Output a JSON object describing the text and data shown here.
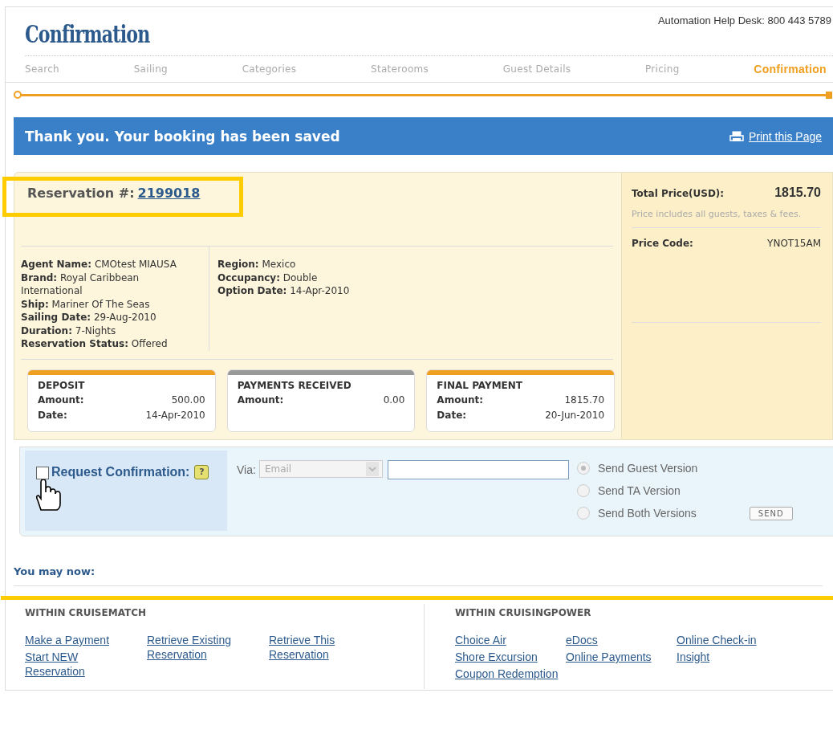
{
  "header": {
    "title": "Confirmation",
    "help_desk": "Automation Help Desk: 800 443 5789"
  },
  "steps": [
    {
      "label": "Search",
      "selected": false
    },
    {
      "label": "Sailing",
      "selected": false
    },
    {
      "label": "Categories",
      "selected": false
    },
    {
      "label": "Staterooms",
      "selected": false
    },
    {
      "label": "Guest Details",
      "selected": false
    },
    {
      "label": "Pricing",
      "selected": false
    },
    {
      "label": "Confirmation",
      "selected": true
    }
  ],
  "banner": {
    "title": "Thank you. Your booking has been saved",
    "print_link": "Print this Page"
  },
  "reservation": {
    "label": "Reservation #:",
    "number": "2199018"
  },
  "details_left": [
    {
      "label": "Agent Name:",
      "value": "CMOtest MIAUSA"
    },
    {
      "label": "Brand:",
      "value": "Royal Caribbean International"
    },
    {
      "label": "Ship:",
      "value": "Mariner Of The Seas"
    },
    {
      "label": "Sailing Date:",
      "value": "29-Aug-2010"
    },
    {
      "label": "Duration:",
      "value": "7-Nights"
    },
    {
      "label": "Reservation Status:",
      "value": "Offered"
    }
  ],
  "details_right": [
    {
      "label": "Region:",
      "value": "Mexico"
    },
    {
      "label": "Occupancy:",
      "value": "Double"
    },
    {
      "label": "Option Date:",
      "value": "14-Apr-2010"
    }
  ],
  "payments": [
    {
      "title": "DEPOSIT",
      "color": "#f0a020",
      "rows": [
        {
          "label": "Amount:",
          "value": "500.00"
        },
        {
          "label": "Date:",
          "value": "14-Apr-2010"
        }
      ]
    },
    {
      "title": "PAYMENTS RECEIVED",
      "color": "#999999",
      "rows": [
        {
          "label": "Amount:",
          "value": "0.00"
        }
      ]
    },
    {
      "title": "FINAL PAYMENT",
      "color": "#f0a020",
      "rows": [
        {
          "label": "Amount:",
          "value": "1815.70"
        },
        {
          "label": "Date:",
          "value": "20-Jun-2010"
        }
      ]
    }
  ],
  "price": {
    "total_label": "Total Price(USD):",
    "total_value": "1815.70",
    "note": "Price includes all guests, taxes & fees.",
    "code_label": "Price Code:",
    "code_value": "YNOT15AM"
  },
  "request": {
    "label": "Request Confirmation:",
    "checked": false,
    "help": "?",
    "via_label": "Via:",
    "via_value": "Email",
    "versions": [
      {
        "label": "Send Guest Version",
        "selected": true
      },
      {
        "label": "Send TA Version",
        "selected": false
      },
      {
        "label": "Send Both Versions",
        "selected": false
      }
    ],
    "send": "SEND"
  },
  "you_may_now": "You may now:",
  "link_sections": [
    {
      "title": "WITHIN CRUISEMATCH",
      "columns": [
        [
          "Make a Payment",
          "Start NEW Reservation"
        ],
        [
          "Retrieve Existing Reservation"
        ],
        [
          "Retrieve This Reservation"
        ]
      ]
    },
    {
      "title": "WITHIN CRUISINGPOWER",
      "columns": [
        [
          "Choice Air",
          "Shore Excursion",
          "Coupon Redemption"
        ],
        [
          "eDocs",
          "Online Payments"
        ],
        [
          "Online Check-in",
          "Insight"
        ]
      ]
    }
  ]
}
